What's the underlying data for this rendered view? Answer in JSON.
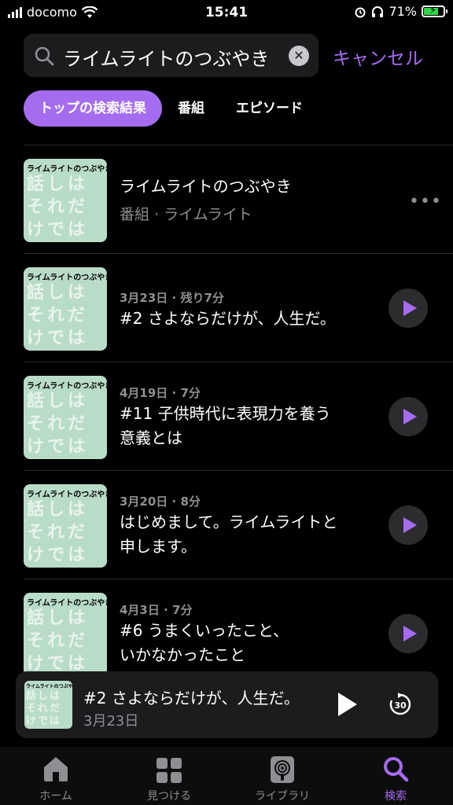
{
  "status_bar": {
    "carrier": "docomo",
    "time": "15:41",
    "battery": "71%"
  },
  "search": {
    "query": "ライムライトのつぶやき",
    "clear_icon": "clear-icon",
    "cancel_label": "キャンセル"
  },
  "filters": [
    {
      "label": "トップの検索結果",
      "active": true
    },
    {
      "label": "番組",
      "active": false
    },
    {
      "label": "エピソード",
      "active": false
    }
  ],
  "artwork": {
    "title_text": "ライムライトのつぶやき",
    "big_text": "話しはそれだけではない"
  },
  "results": [
    {
      "type": "show",
      "title": "ライムライトのつぶやき",
      "subtitle": "番組 · ライムライト",
      "action": "more-icon"
    },
    {
      "type": "episode",
      "meta": "3月23日 · 残り7分",
      "title_line1": "#2 さよならだけが、人生だ。",
      "title_line2": "",
      "action": "play-icon"
    },
    {
      "type": "episode",
      "meta": "4月19日 · 7分",
      "title_line1": "#11 子供時代に表現力を養う",
      "title_line2": "意義とは",
      "action": "play-icon"
    },
    {
      "type": "episode",
      "meta": "3月20日 · 8分",
      "title_line1": "はじめまして。ライムライトと",
      "title_line2": "申します。",
      "action": "play-icon"
    },
    {
      "type": "episode",
      "meta": "4月3日 · 7分",
      "title_line1": "#6 うまくいったこと、",
      "title_line2": "いかなかったこと",
      "action": "play-icon"
    }
  ],
  "mini_player": {
    "title": "#2 さよならだけが、人生だ。",
    "date": "3月23日",
    "skip_label": "30"
  },
  "tabs": [
    {
      "label": "ホーム",
      "icon": "home-icon",
      "active": false
    },
    {
      "label": "見つける",
      "icon": "grid-icon",
      "active": false
    },
    {
      "label": "ライブラリ",
      "icon": "library-icon",
      "active": false
    },
    {
      "label": "検索",
      "icon": "search-icon",
      "active": true
    }
  ],
  "colors": {
    "accent": "#a56cf0",
    "background": "#000000",
    "secondary_text": "#8e8e93",
    "battery": "#32d74b"
  }
}
